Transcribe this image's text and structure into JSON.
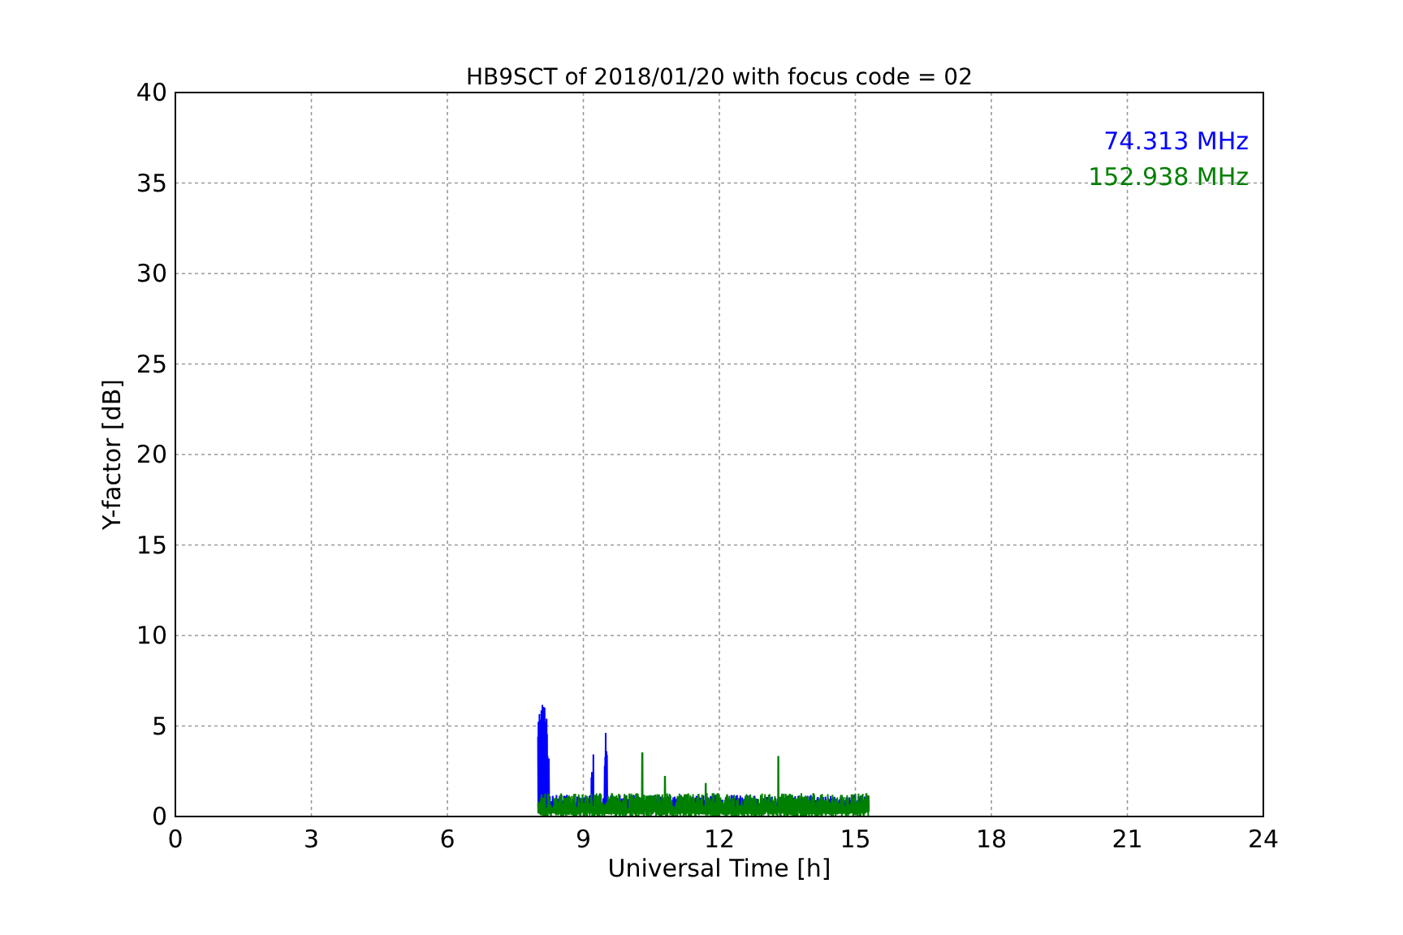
{
  "title": "HB9SCT of 2018/01/20 with focus code = 02",
  "xlabel": "Universal Time [h]",
  "ylabel": "Y-factor [dB]",
  "xticks": [
    "0",
    "3",
    "6",
    "9",
    "12",
    "15",
    "18",
    "21",
    "24"
  ],
  "yticks": [
    "40",
    "35",
    "30",
    "25",
    "20",
    "15",
    "10",
    "5",
    "0"
  ],
  "legend": [
    {
      "label": "74.313 MHz",
      "color": "#0000ff"
    },
    {
      "label": "152.938 MHz",
      "color": "#008000"
    }
  ]
}
